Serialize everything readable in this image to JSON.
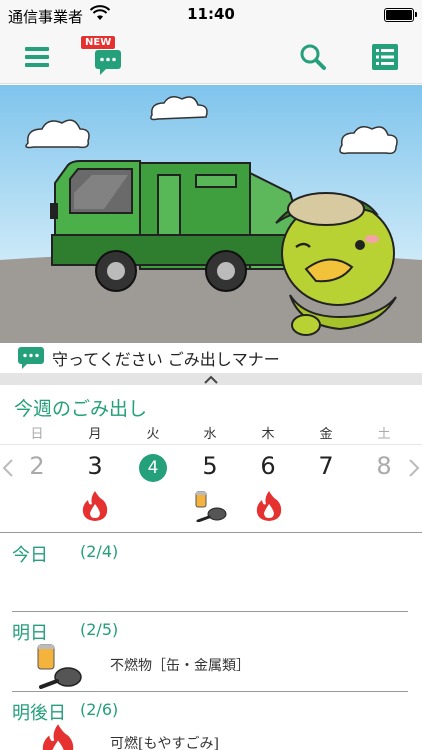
{
  "status": {
    "carrier": "通信事業者",
    "time": "11:40"
  },
  "nav": {
    "news_badge": "NEW"
  },
  "notice": {
    "text": "守ってください ごみ出しマナー"
  },
  "week": {
    "title": "今週のごみ出し",
    "days": [
      "日",
      "月",
      "火",
      "水",
      "木",
      "金",
      "土"
    ],
    "dates": [
      "2",
      "3",
      "4",
      "5",
      "6",
      "7",
      "8"
    ],
    "today_index": 2
  },
  "schedule": {
    "today": {
      "title": "今日",
      "date": "(2/4)"
    },
    "tomorrow": {
      "title": "明日",
      "date": "(2/5)",
      "item": "不燃物［缶・金属類］"
    },
    "day_after": {
      "title": "明後日",
      "date": "(2/6)",
      "item": "可燃[もやすごみ]"
    }
  },
  "colors": {
    "accent": "#24a07a",
    "burnable": "#e5312f",
    "badge": "#e5312f"
  }
}
